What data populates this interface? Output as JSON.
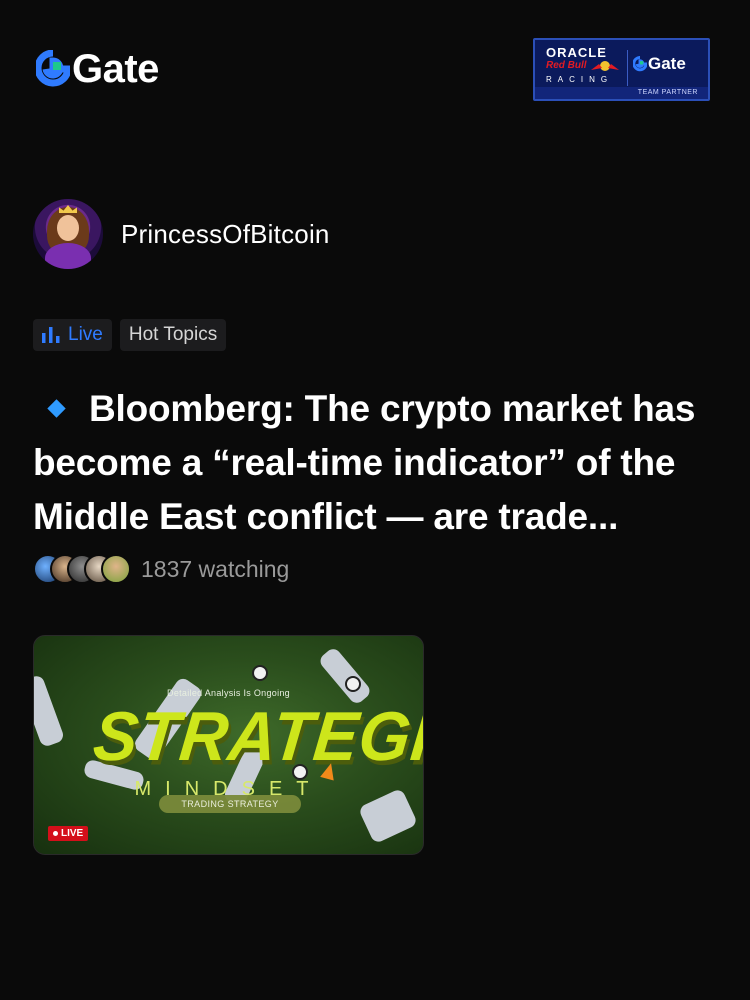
{
  "brand": {
    "logo_text": "Gate",
    "logo_color": "#2f7bff"
  },
  "partner": {
    "oracle": "ORACLE",
    "redbull": "Red Bull",
    "racing": "RACING",
    "gate": "Gate",
    "team": "TEAM PARTNER"
  },
  "author": {
    "name": "PrincessOfBitcoin"
  },
  "tags": {
    "live": "Live",
    "hot": "Hot Topics"
  },
  "post": {
    "title": "Bloomberg: The crypto market has become a “real-time indicator” of the Middle East conflict — are trade...",
    "watching": "1837 watching"
  },
  "thumbnail": {
    "analysis": "Detailed Analysis Is Ongoing",
    "headline": "STRATEGIC",
    "subline": "MINDSET",
    "pill": "TRADING STRATEGY",
    "live_badge": "LIVE"
  },
  "colors": {
    "accent": "#2f7bff",
    "background": "#0a0a0a",
    "live_red": "#d40f1a"
  }
}
